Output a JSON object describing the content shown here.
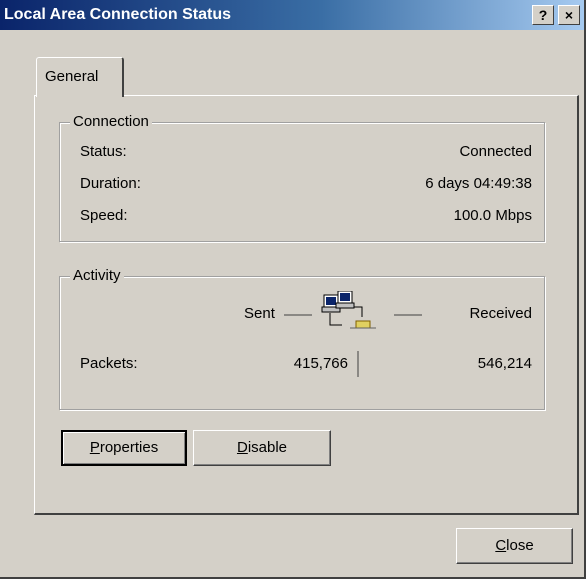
{
  "window": {
    "title": "Local Area Connection Status",
    "help_button": "?",
    "close_glyph": "×"
  },
  "tabs": [
    {
      "label": "General",
      "selected": true
    }
  ],
  "connection": {
    "group_title": "Connection",
    "status_label": "Status:",
    "status_value": "Connected",
    "duration_label": "Duration:",
    "duration_value": "6 days 04:49:38",
    "speed_label": "Speed:",
    "speed_value": "100.0 Mbps"
  },
  "activity": {
    "group_title": "Activity",
    "sent_label": "Sent",
    "received_label": "Received",
    "packets_label": "Packets:",
    "packets_sent": "415,766",
    "packets_received": "546,214",
    "icon": "network-computers-icon"
  },
  "buttons": {
    "properties_label": "Properties",
    "properties_mnemonic": "P",
    "properties_rest": "roperties",
    "disable_label": "Disable",
    "disable_mnemonic": "D",
    "disable_rest": "isable",
    "close_label": "Close",
    "close_mnemonic": "C",
    "close_rest": "lose"
  },
  "colors": {
    "titlebar_start": "#0a246a",
    "titlebar_end": "#a6caf0",
    "face": "#d4d0c8"
  }
}
